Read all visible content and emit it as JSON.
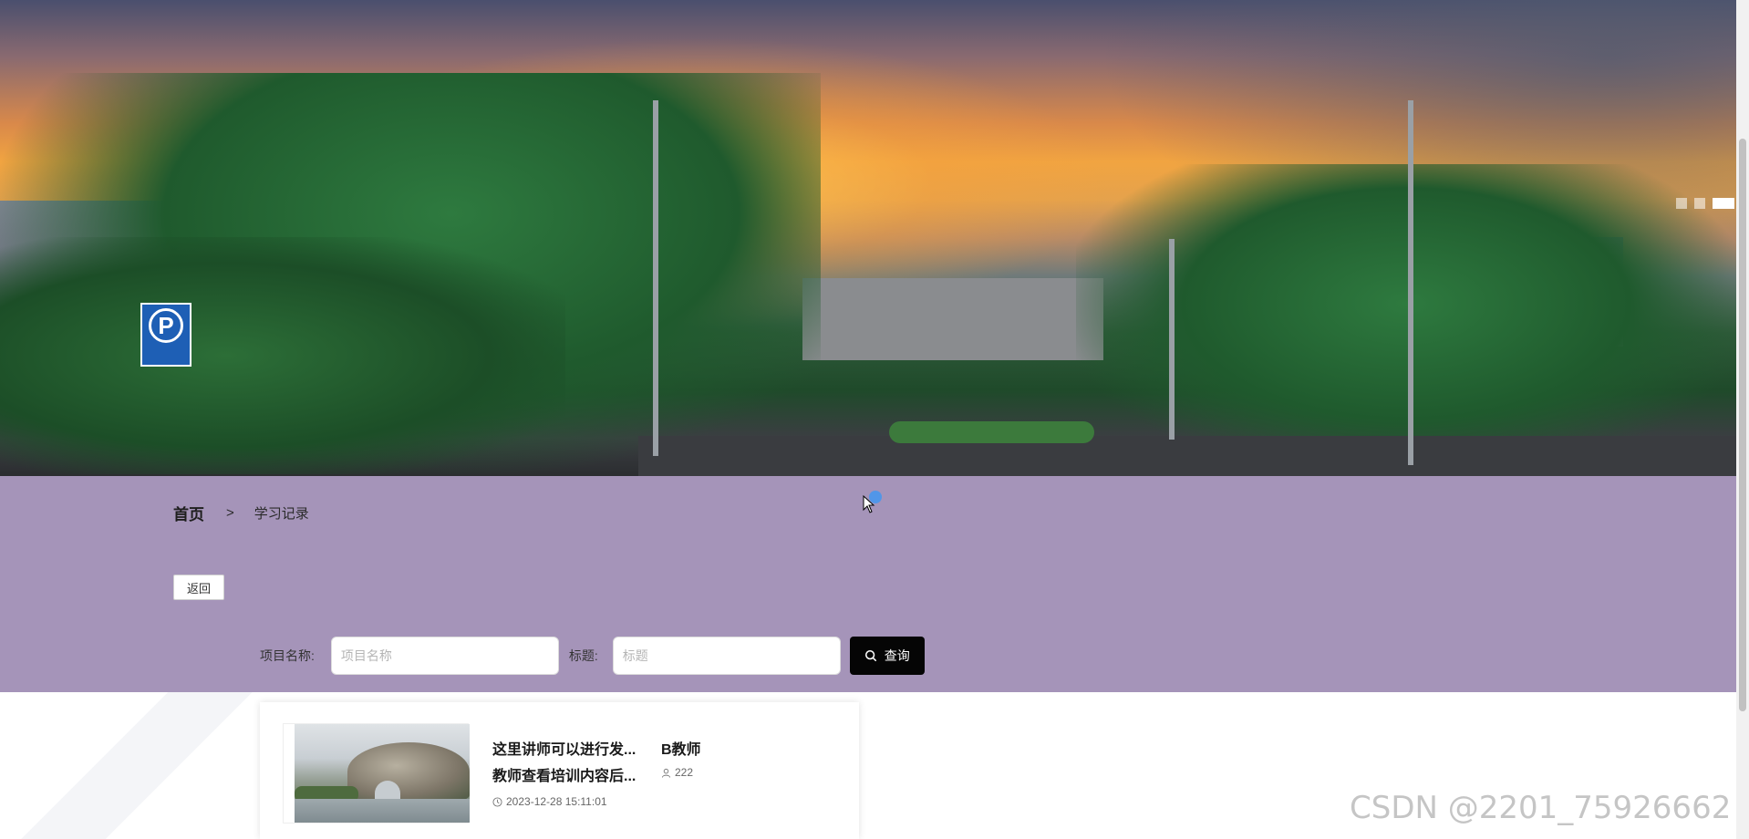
{
  "banner": {
    "carousel_dots": 3,
    "active_dot": 3
  },
  "breadcrumb": {
    "home": "首页",
    "separator": ">",
    "current": "学习记录"
  },
  "back_button": "返回",
  "search": {
    "project_label": "项目名称:",
    "project_placeholder": "项目名称",
    "title_label": "标题:",
    "title_placeholder": "标题",
    "button_label": "查询"
  },
  "records": [
    {
      "title": "这里讲师可以进行发...",
      "subtitle": "教师查看培训内容后...",
      "teacher": "B教师",
      "views": "222",
      "time": "2023-12-28 15:11:01"
    }
  ],
  "watermark": "CSDN @2201_75926662",
  "colors": {
    "band": "#a594b9",
    "search_button": "#050505"
  }
}
